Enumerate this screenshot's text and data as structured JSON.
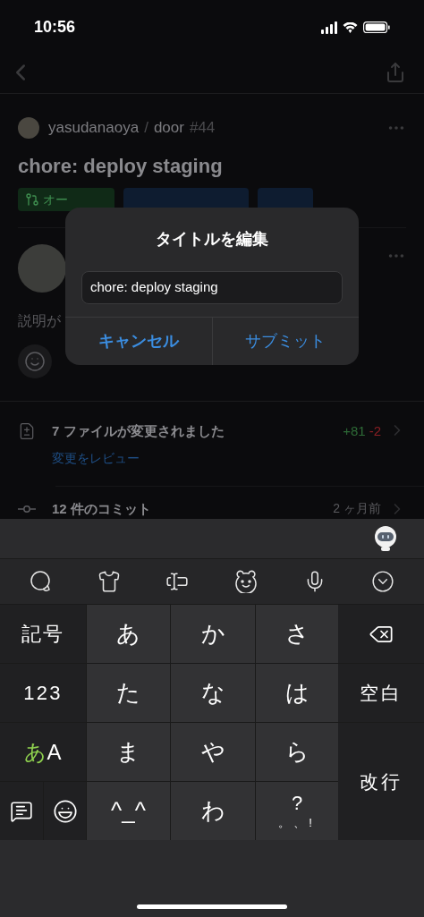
{
  "status_bar": {
    "time": "10:56"
  },
  "repo": {
    "owner": "yasudanaoya",
    "separator": "/",
    "name": "door",
    "number": "#44"
  },
  "title": "chore: deploy staging",
  "tags": [
    {
      "kind": "state",
      "label": "オー"
    },
    {
      "kind": "branch"
    },
    {
      "kind": "branch"
    }
  ],
  "description": "説明が",
  "files": {
    "title": "7 ファイルが変更されました",
    "link": "変更をレビュー",
    "additions": "+81",
    "deletions": "-2"
  },
  "commits": {
    "title": "12 件のコミット",
    "time": "2 ヶ月前"
  },
  "dialog": {
    "title": "タイトルを編集",
    "value": "chore: deploy staging",
    "buttons": [
      {
        "label": "キャンセル",
        "bold": true
      },
      {
        "label": "サブミット",
        "bold": false
      }
    ]
  },
  "keyboard": {
    "keys": [
      {
        "kind": "action",
        "label": "記号"
      },
      {
        "kind": "kana",
        "label": "あ"
      },
      {
        "kind": "kana",
        "label": "か"
      },
      {
        "kind": "kana",
        "label": "さ"
      },
      {
        "kind": "backspace"
      },
      {
        "kind": "action",
        "label": "123"
      },
      {
        "kind": "kana",
        "label": "た"
      },
      {
        "kind": "kana",
        "label": "な"
      },
      {
        "kind": "kana",
        "label": "は"
      },
      {
        "kind": "side",
        "label": "空白"
      },
      {
        "kind": "mode",
        "active": "あ",
        "other": "A"
      },
      {
        "kind": "kana",
        "label": "ま"
      },
      {
        "kind": "kana",
        "label": "や"
      },
      {
        "kind": "kana",
        "label": "ら"
      },
      {
        "kind": "enter",
        "label": "改行"
      },
      {
        "kind": "chat"
      },
      {
        "kind": "emoji"
      },
      {
        "kind": "kana",
        "label": "^_^"
      },
      {
        "kind": "kana",
        "label": "わ"
      },
      {
        "kind": "punct",
        "label": "?",
        "sub": "。、!"
      }
    ]
  }
}
